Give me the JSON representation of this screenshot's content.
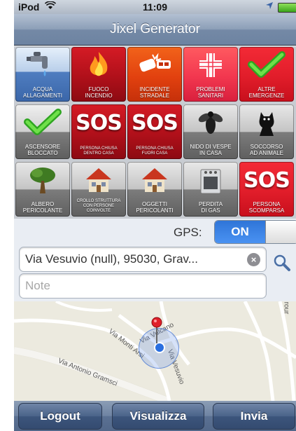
{
  "status_bar": {
    "carrier": "iPod",
    "time": "11:09"
  },
  "nav": {
    "title": "Jixel Generator"
  },
  "tiles": [
    {
      "label": "ACQUA\nALLAGAMENTI"
    },
    {
      "label": "FUOCO\nINCENDIO"
    },
    {
      "label": "INCIDENTE\nSTRADALE"
    },
    {
      "label": "PROBLEMI\nSANITARI"
    },
    {
      "label": "ALTRE\nEMERGENZE"
    },
    {
      "label": "ASCENSORE\nBLOCCATO"
    },
    {
      "label": "PERSONA CHIUSA\nDENTRO CASA",
      "icon_text": "SOS"
    },
    {
      "label": "PERSONA CHIUSA\nFUORI CASA",
      "icon_text": "SOS"
    },
    {
      "label": "NIDO DI VESPE\nIN CASA"
    },
    {
      "label": "SOCCORSO\nAD ANIMALE"
    },
    {
      "label": "ALBERO\nPERICOLANTE"
    },
    {
      "label": "CROLLO STRUTTURA\nCON PERSONE\nCOINVOLTE"
    },
    {
      "label": "OGGETTI\nPERICOLANTI"
    },
    {
      "label": "PERDITA\nDI GAS"
    },
    {
      "label": "PERSONA\nSCOMPARSA",
      "icon_text": "SOS"
    }
  ],
  "gps": {
    "label": "GPS:",
    "state": "ON"
  },
  "address": {
    "value": "Via Vesuvio (null), 95030, Grav..."
  },
  "note": {
    "placeholder": "Note"
  },
  "map": {
    "labels": {
      "vulcano": "Via Vulcano",
      "monti_arsi": "Via Monti Arsi",
      "gramsci": "Via Antonio Gramsci",
      "vesuvio": "Via Vesuvio",
      "corner": "rour"
    }
  },
  "tabbar": {
    "logout": "Logout",
    "visualizza": "Visualizza",
    "invia": "Invia"
  },
  "colors": {
    "accent": "#3a82e6",
    "nav": "#7d91ad"
  }
}
